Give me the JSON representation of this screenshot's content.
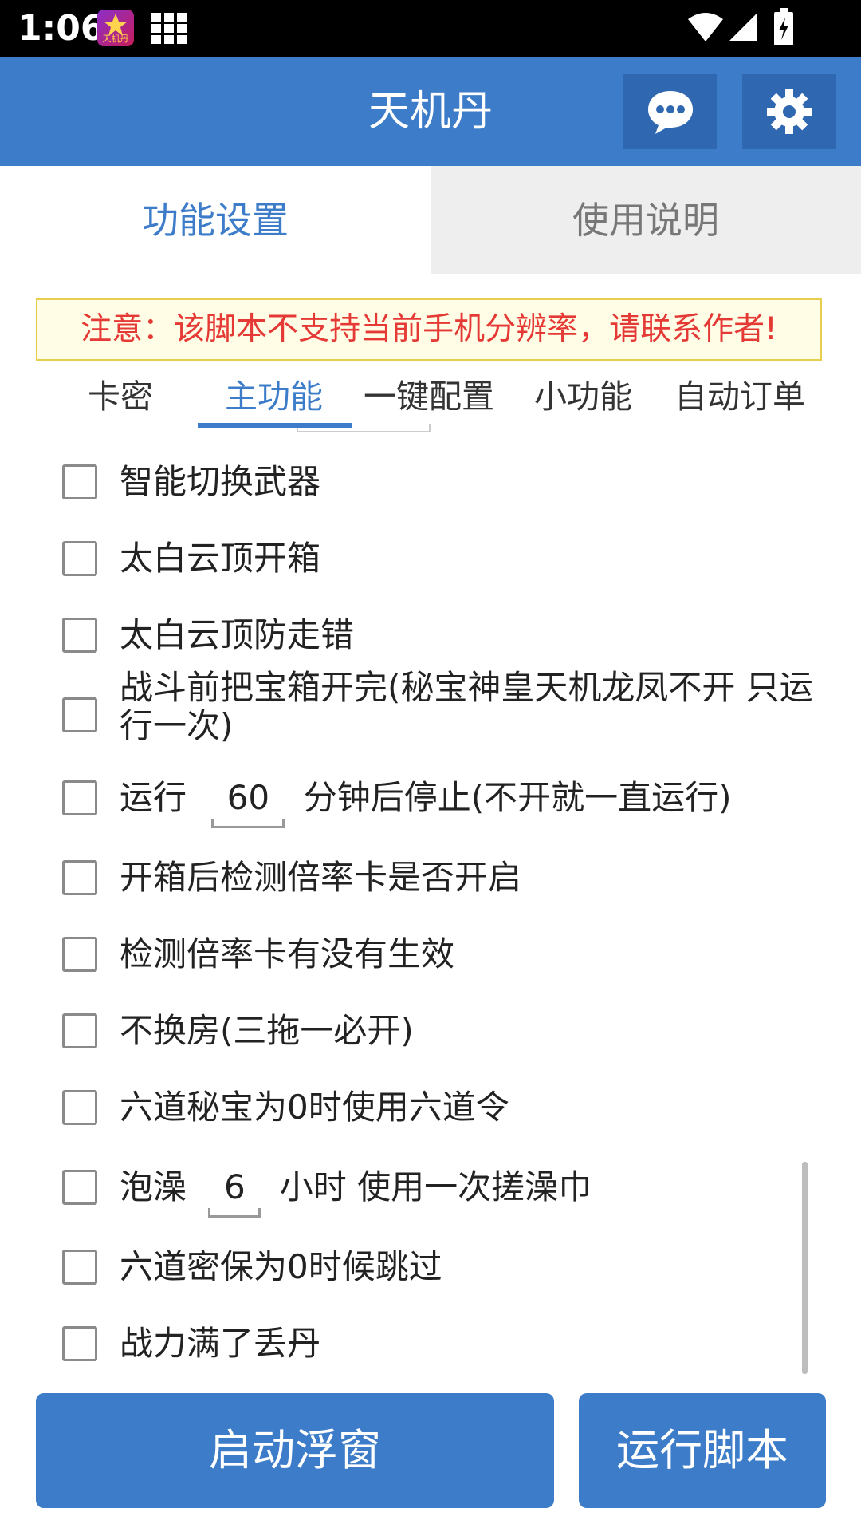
{
  "status_bar": {
    "time": "1:06",
    "app_icon_text": "天机丹"
  },
  "app_bar": {
    "title": "天机丹"
  },
  "tabs": [
    {
      "label": "功能设置",
      "active": true
    },
    {
      "label": "使用说明",
      "active": false
    }
  ],
  "notice": "注意：该脚本不支持当前手机分辨率，请联系作者!",
  "subtabs": [
    {
      "label": "卡密"
    },
    {
      "label": "主功能",
      "active": true
    },
    {
      "label": "一键配置"
    },
    {
      "label": "小功能"
    },
    {
      "label": "自动订单"
    }
  ],
  "options": [
    {
      "label": "智能切换武器",
      "checked": false
    },
    {
      "label": "太白云顶开箱",
      "checked": false
    },
    {
      "label": "太白云顶防走错",
      "checked": false
    },
    {
      "label": "战斗前把宝箱开完(秘宝神皇天机龙凤不开 只运行一次)",
      "checked": false
    },
    {
      "prefix": "运行",
      "value": "60",
      "suffix": "分钟后停止(不开就一直运行)",
      "checked": false
    },
    {
      "label": "开箱后检测倍率卡是否开启",
      "checked": false
    },
    {
      "label": "检测倍率卡有没有生效",
      "checked": false
    },
    {
      "label": "不换房(三拖一必开)",
      "checked": false
    },
    {
      "label": "六道秘宝为0时使用六道令",
      "checked": false
    },
    {
      "prefix": "泡澡",
      "value": "6",
      "suffix": "小时 使用一次搓澡巾",
      "checked": false
    },
    {
      "label": "六道密保为0时候跳过",
      "checked": false
    },
    {
      "label": "战力满了丢丹",
      "checked": false
    }
  ],
  "buttons": {
    "start_float": "启动浮窗",
    "run_script": "运行脚本"
  },
  "colors": {
    "primary": "#3d7cc9",
    "notice_text": "#e53935",
    "notice_bg": "#fffde6"
  }
}
